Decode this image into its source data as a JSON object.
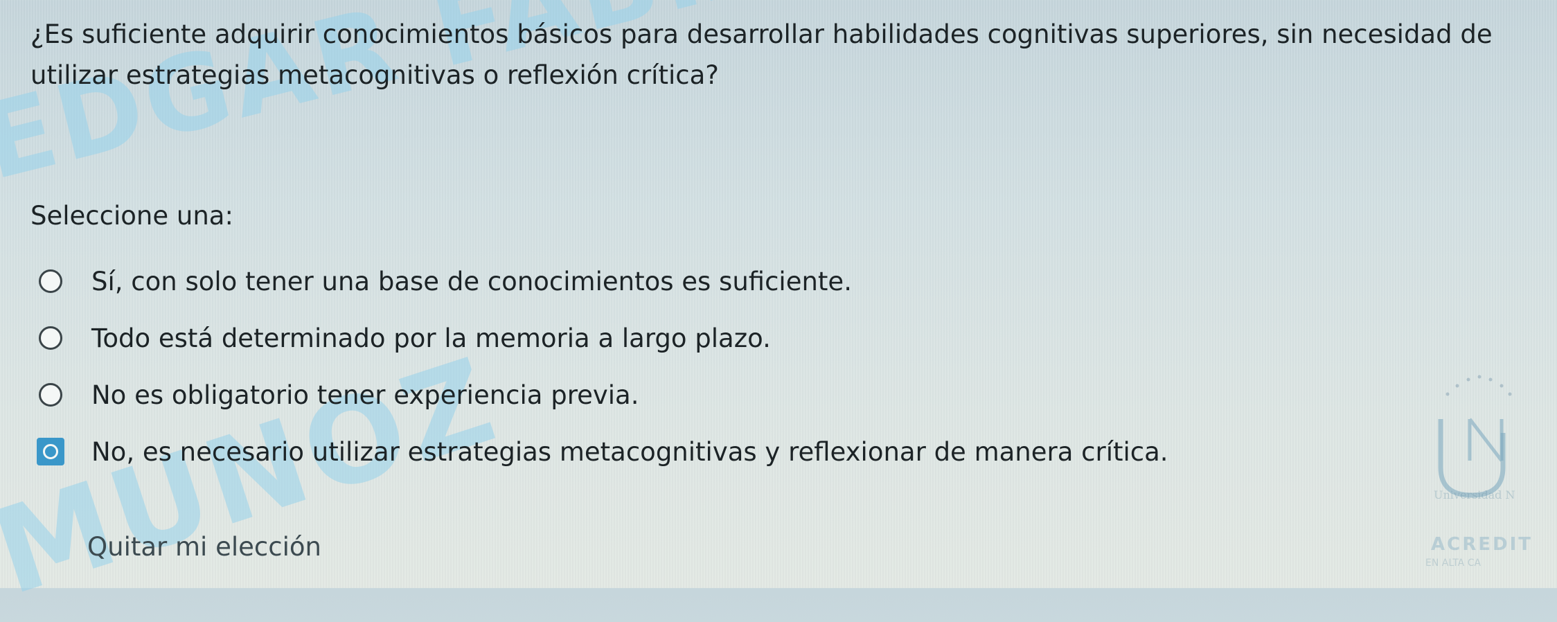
{
  "question": {
    "text": "¿Es suficiente adquirir conocimientos básicos para desarrollar habilidades cognitivas superiores, sin necesidad de utilizar estrategias metacognitivas o reflexión crítica?"
  },
  "prompt": "Seleccione una:",
  "options": [
    {
      "label": "Sí, con solo tener una base de conocimientos es suficiente.",
      "selected": false
    },
    {
      "label": "Todo está determinado por la memoria a largo plazo.",
      "selected": false
    },
    {
      "label": "No es obligatorio tener experiencia previa.",
      "selected": false
    },
    {
      "label": "No, es necesario utilizar estrategias metacognitivas y reflexionar de manera crítica.",
      "selected": true
    }
  ],
  "clear_choice": "Quitar mi elección",
  "watermark": {
    "line1": "EDGAR FABIAN CAJAS",
    "line2": "MUNOZ"
  },
  "logo": {
    "mark": "UN",
    "university": "Universidad N",
    "accreditation": "ACREDIT",
    "subtitle": "EN ALTA CA"
  },
  "colors": {
    "accent": "#3a97c9",
    "watermark": "#96d2eb",
    "text": "#1c2326"
  }
}
